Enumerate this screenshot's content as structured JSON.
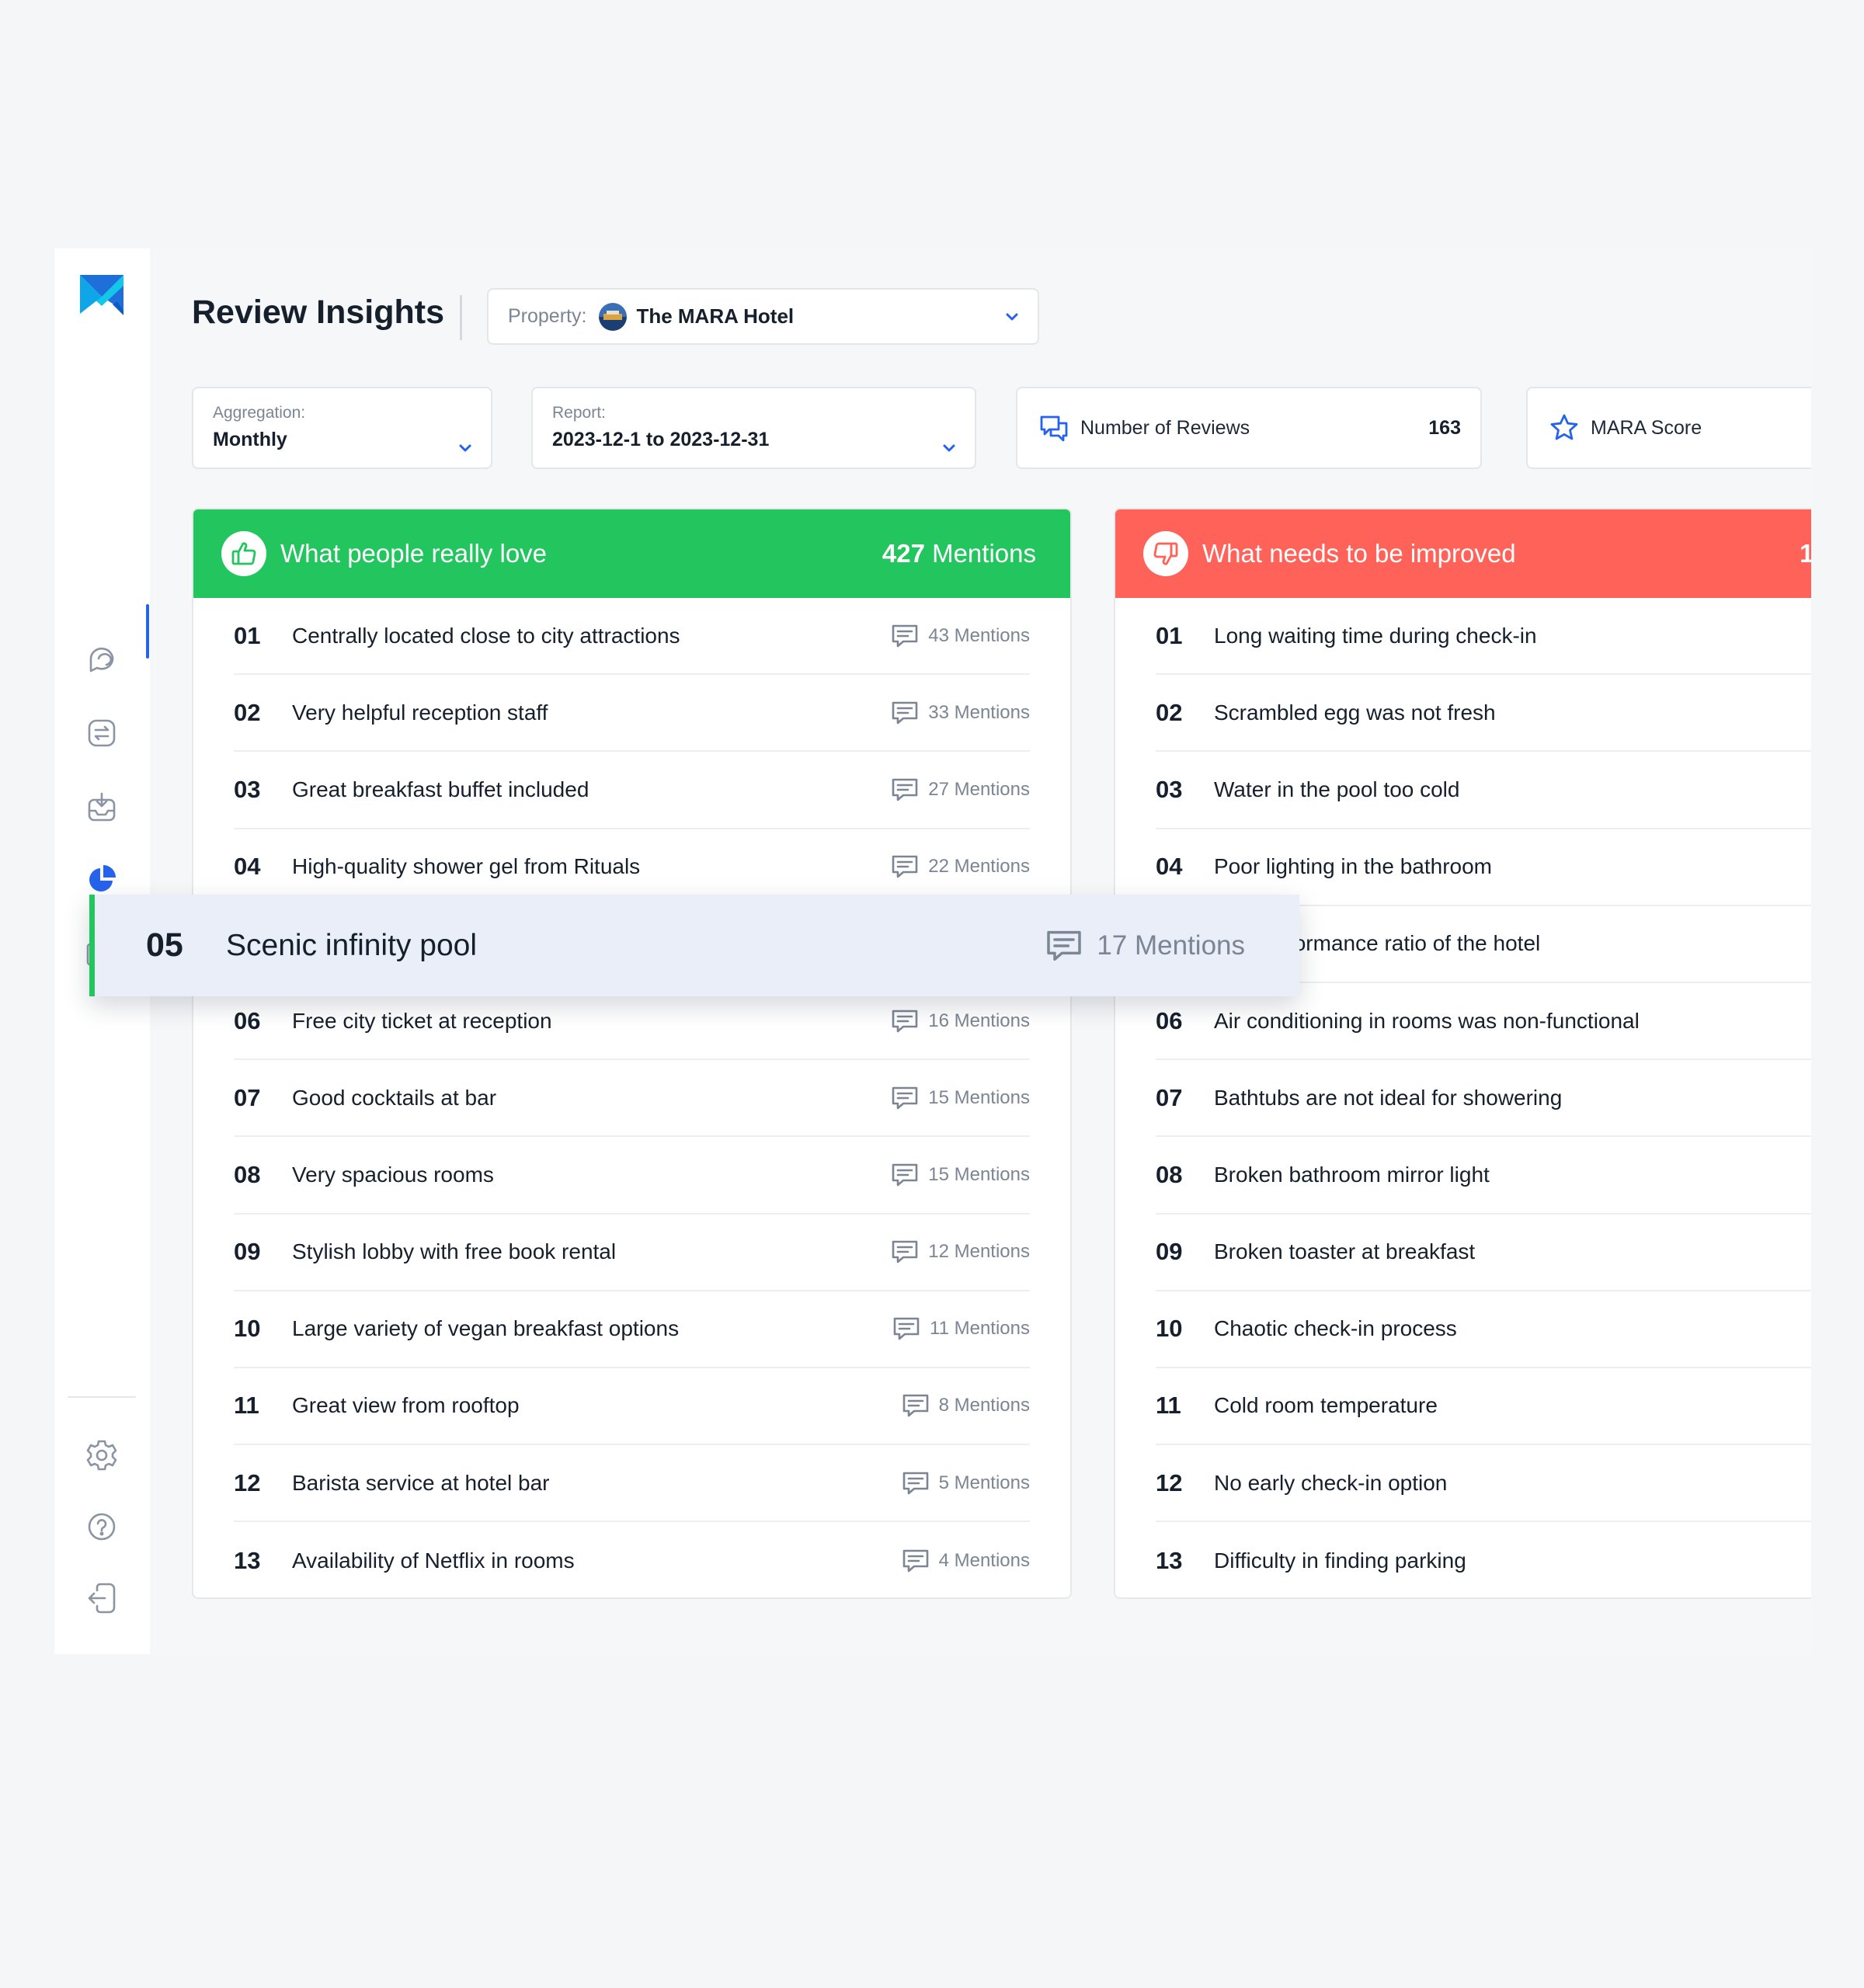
{
  "app": {
    "title": "Review Insights",
    "brand_color": "#0ea5e9",
    "accent_color": "#2563eb"
  },
  "sidebar": {
    "items": [
      {
        "name": "chat-icon",
        "active": false
      },
      {
        "name": "exchange-icon",
        "active": false
      },
      {
        "name": "inbox-icon",
        "active": false
      },
      {
        "name": "pie-chart-icon",
        "active": true
      },
      {
        "name": "documents-icon",
        "active": false
      }
    ],
    "bottom": [
      {
        "name": "gear-icon"
      },
      {
        "name": "help-icon"
      },
      {
        "name": "logout-icon"
      }
    ]
  },
  "header": {
    "property_label": "Property:",
    "property_value": "The MARA Hotel"
  },
  "filters": {
    "aggregation_label": "Aggregation:",
    "aggregation_value": "Monthly",
    "report_label": "Report:",
    "report_value": "2023-12-1 to 2023-12-31"
  },
  "stats": {
    "reviews_label": "Number of Reviews",
    "reviews_value": "163",
    "score_label": "MARA Score"
  },
  "love": {
    "title": "What people really love",
    "count": "427",
    "count_suffix": " Mentions",
    "color": "#22c55e",
    "rows": [
      {
        "num": "01",
        "text": "Centrally located close to city attractions",
        "mentions": "43 Mentions"
      },
      {
        "num": "02",
        "text": "Very helpful reception staff",
        "mentions": "33 Mentions"
      },
      {
        "num": "03",
        "text": "Great breakfast buffet included",
        "mentions": "27 Mentions"
      },
      {
        "num": "04",
        "text": "High-quality shower gel from Rituals",
        "mentions": "22 Mentions"
      },
      {
        "num": "",
        "text": "",
        "mentions": ""
      },
      {
        "num": "06",
        "text": "Free city ticket at reception",
        "mentions": "16 Mentions"
      },
      {
        "num": "07",
        "text": "Good cocktails at bar",
        "mentions": "15 Mentions"
      },
      {
        "num": "08",
        "text": "Very spacious rooms",
        "mentions": "15 Mentions"
      },
      {
        "num": "09",
        "text": "Stylish lobby with free book rental",
        "mentions": "12 Mentions"
      },
      {
        "num": "10",
        "text": "Large variety of vegan breakfast options",
        "mentions": "11 Mentions"
      },
      {
        "num": "11",
        "text": "Great  view from rooftop",
        "mentions": "8 Mentions"
      },
      {
        "num": "12",
        "text": "Barista service at hotel bar",
        "mentions": "5 Mentions"
      },
      {
        "num": "13",
        "text": "Availability of Netflix in rooms",
        "mentions": "4 Mentions"
      }
    ]
  },
  "improve": {
    "title": "What needs to be improved",
    "count_partial": "1",
    "color": "#ff6259",
    "rows": [
      {
        "num": "01",
        "text": "Long waiting time during check-in"
      },
      {
        "num": "02",
        "text": "Scrambled egg was not fresh"
      },
      {
        "num": "03",
        "text": "Water in the pool too cold"
      },
      {
        "num": "04",
        "text": "Poor lighting in the bathroom"
      },
      {
        "num": "",
        "text": "e to performance ratio of the hotel"
      },
      {
        "num": "06",
        "text": "Air conditioning in rooms was non-functional"
      },
      {
        "num": "07",
        "text": "Bathtubs are not ideal for showering"
      },
      {
        "num": "08",
        "text": "Broken bathroom mirror light"
      },
      {
        "num": "09",
        "text": "Broken toaster at breakfast"
      },
      {
        "num": "10",
        "text": "Chaotic check-in process"
      },
      {
        "num": "11",
        "text": "Cold room temperature"
      },
      {
        "num": "12",
        "text": "No early check-in option"
      },
      {
        "num": "13",
        "text": "Difficulty in finding parking"
      }
    ]
  },
  "dragged_row": {
    "num": "05",
    "text": "Scenic infinity pool",
    "mentions": "17 Mentions"
  }
}
